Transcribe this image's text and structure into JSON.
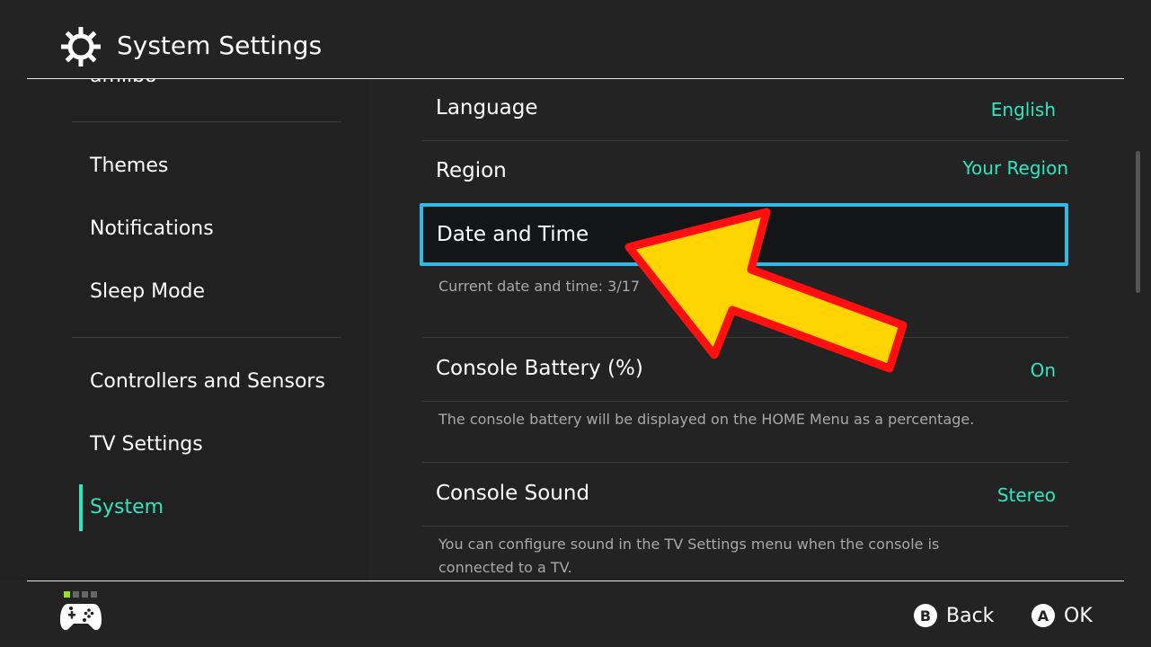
{
  "header": {
    "title": "System Settings",
    "icon": "gear-icon"
  },
  "sidebar": {
    "items": [
      {
        "label": "amiibo",
        "active": false
      },
      {
        "label": "Themes",
        "active": false
      },
      {
        "label": "Notifications",
        "active": false
      },
      {
        "label": "Sleep Mode",
        "active": false
      },
      {
        "label": "Controllers and Sensors",
        "active": false
      },
      {
        "label": "TV Settings",
        "active": false
      },
      {
        "label": "System",
        "active": true
      }
    ]
  },
  "content": {
    "rows": [
      {
        "label": "Language",
        "value": "English"
      },
      {
        "label": "Region",
        "value": "Your Region"
      },
      {
        "label": "Date and Time",
        "value": "",
        "selected": true,
        "description": "Current date and time: 3/17"
      },
      {
        "label": "Console Battery (%)",
        "value": "On",
        "description": "The console battery will be displayed on the HOME Menu as a percentage."
      },
      {
        "label": "Console Sound",
        "value": "Stereo",
        "description": "You can configure sound in the TV Settings menu when the console is connected to a TV."
      }
    ]
  },
  "footer": {
    "player_indicator": {
      "active_player": 1,
      "total": 4
    },
    "back": {
      "glyph": "B",
      "label": "Back"
    },
    "ok": {
      "glyph": "A",
      "label": "OK"
    }
  },
  "annotation": {
    "type": "arrow",
    "fill": "#ffd400",
    "stroke": "#ff1010",
    "points_to": "Date and Time"
  },
  "colors": {
    "accent": "#2ee6c0",
    "selection_border": "#30b8e6",
    "background": "#232323"
  }
}
